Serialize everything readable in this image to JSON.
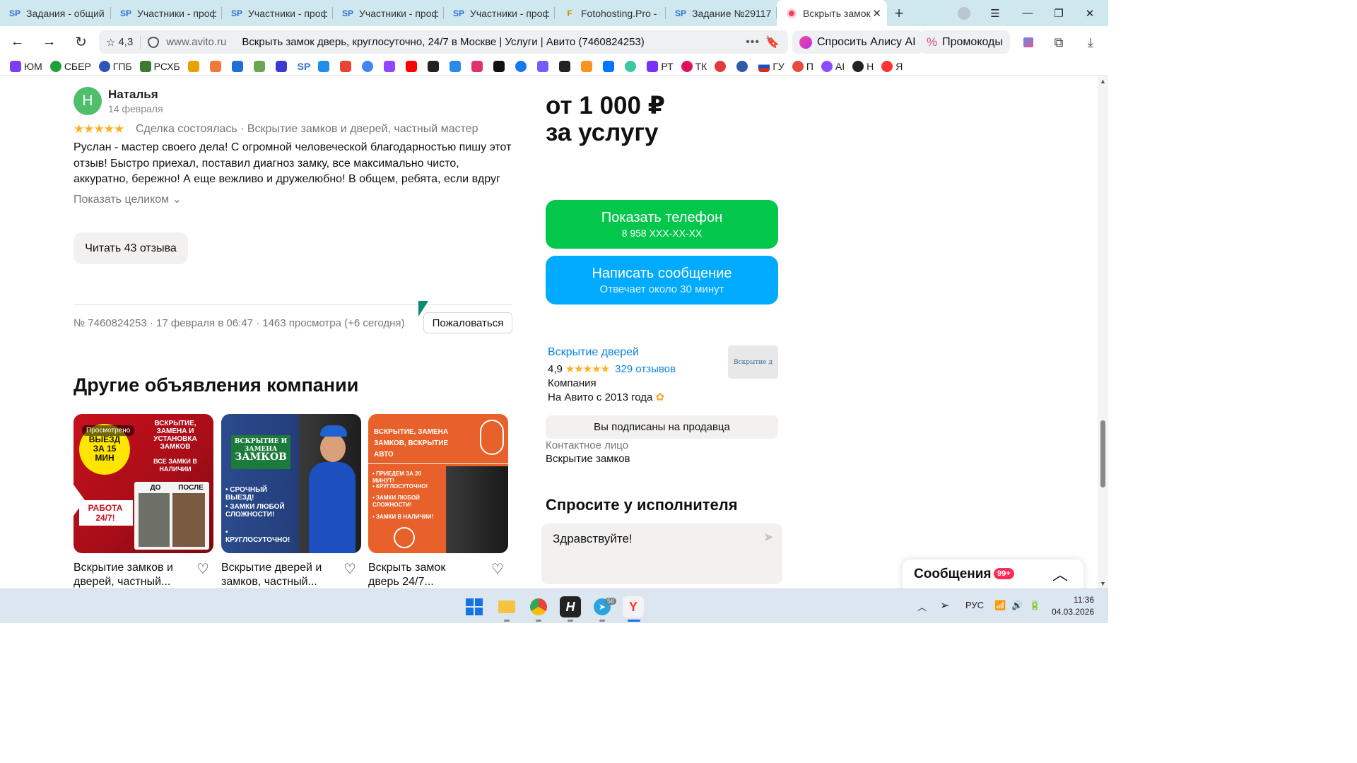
{
  "browser": {
    "tabs": [
      {
        "label": "Задания - общий с",
        "icon": "SP"
      },
      {
        "label": "Участники - проф",
        "icon": "SP"
      },
      {
        "label": "Участники - проф",
        "icon": "SP"
      },
      {
        "label": "Участники - проф",
        "icon": "SP"
      },
      {
        "label": "Участники - проф",
        "icon": "SP"
      },
      {
        "label": "Fotohosting.Pro - ф",
        "icon": "F"
      },
      {
        "label": "Задание №29117",
        "icon": "SP"
      },
      {
        "label": "Вскрыть замок",
        "icon": "avito"
      }
    ],
    "rating": "4,3",
    "domain": "www.avito.ru",
    "page_title": "Вскрыть замок дверь, круглосуточно, 24/7 в Москве | Услуги | Авито (7460824253)",
    "alice_label": "Спросить Алису AI",
    "promo_label": "Промокоды",
    "bookmarks": [
      "ЮМ",
      "СБЕР",
      "ГПБ",
      "РСХБ",
      "",
      "",
      "",
      "",
      "",
      "SP",
      "",
      "",
      "",
      "",
      "",
      "",
      "",
      "",
      "",
      "",
      "",
      "",
      "",
      "",
      "",
      "РТ",
      "ТК",
      "",
      "",
      "ГУ",
      "П",
      "AI",
      "Н",
      "Я"
    ]
  },
  "review": {
    "avatar_letter": "Н",
    "author": "Наталья",
    "date": "14 февраля",
    "stars": "★★★★★",
    "meta": "Сделка состоялась · Вскрытие замков и дверей, частный мастер",
    "text": "Руслан - мастер своего дела! С огромной человеческой благодарностью пишу этот отзыв! Быстро приехал, поставил диагноз замку, все максимально чисто, аккуратно, бережно! А еще вежливо и дружелюбно! В общем, ребята, если вдруг у...",
    "show_all": "Показать целиком ⌄",
    "read_reviews": "Читать 43 отзыва"
  },
  "ad": {
    "info": "№ 7460824253 · 17 февраля в 06:47 · 1463 просмотра (+6 сегодня)",
    "complain": "Пожаловаться"
  },
  "other_ads": {
    "heading": "Другие объявления компании",
    "cards": [
      {
        "title": "Вскрытие замков и дверей, частный...",
        "viewed": "Просмотрено",
        "img_text": [
          "ВЫЕЗД ЗА 15 МИН",
          "ВСКРЫТИЕ, ЗАМЕНА И УСТАНОВКА ЗАМКОВ",
          "ВСЕ ЗАМКИ В НАЛИЧИИ",
          "ДО",
          "ПОСЛЕ",
          "РАБОТА 24/7!"
        ]
      },
      {
        "title": "Вскрытие дверей и замков, частный...",
        "img_text": [
          "ВСКРЫТИЕ И ЗАМЕНА",
          "ЗАМКОВ",
          "• СРОЧНЫЙ ВЫЕЗД!",
          "• ЗАМКИ ЛЮБОЙ СЛОЖНОСТИ!",
          "• КРУГЛОСУТОЧНО!"
        ]
      },
      {
        "title": "Вскрыть замок дверь 24/7...",
        "img_text": [
          "ВСКРЫТИЕ, ЗАМЕНА ЗАМКОВ, ВСКРЫТИЕ АВТО",
          "• ПРИЕДЕМ ЗА 20 МИНУТ!",
          "• КРУГЛОСУТОЧНО!",
          "• ЗАМКИ ЛЮБОЙ СЛОЖНОСТИ!",
          "• ЗАМКИ В НАЛИЧИИ!"
        ]
      }
    ]
  },
  "sidebar": {
    "price_line1": "от 1 000 ₽",
    "price_line2": "за услугу",
    "phone_button": "Показать телефон",
    "phone_masked": "8 958 XXX-XX-XX",
    "message_button": "Написать сообщение",
    "message_sub": "Отвечает около 30 минут",
    "seller_name": "Вскрытие дверей",
    "seller_rating": "4,9",
    "seller_stars": "★★★★★",
    "seller_reviews": "329 отзывов",
    "seller_type": "Компания",
    "seller_since": "На Авито с 2013 года",
    "seller_logo_text": "Вскрытие д",
    "subscribed": "Вы подписаны на продавца",
    "contact_label": "Контактное лицо",
    "contact_value": "Вскрытие замков",
    "ask_heading": "Спросите у исполнителя",
    "ask_placeholder": "Здравствуйте!"
  },
  "messages_panel": {
    "title": "Сообщения",
    "badge": "99+"
  },
  "taskbar": {
    "language": "РУС",
    "time": "11:36",
    "date": "04.03.2026",
    "telegram_badge": "56"
  },
  "colors": {
    "phone_button": "#03c74b",
    "message_button": "#00aaff",
    "link": "#0a84e0",
    "star": "#ffb021"
  }
}
